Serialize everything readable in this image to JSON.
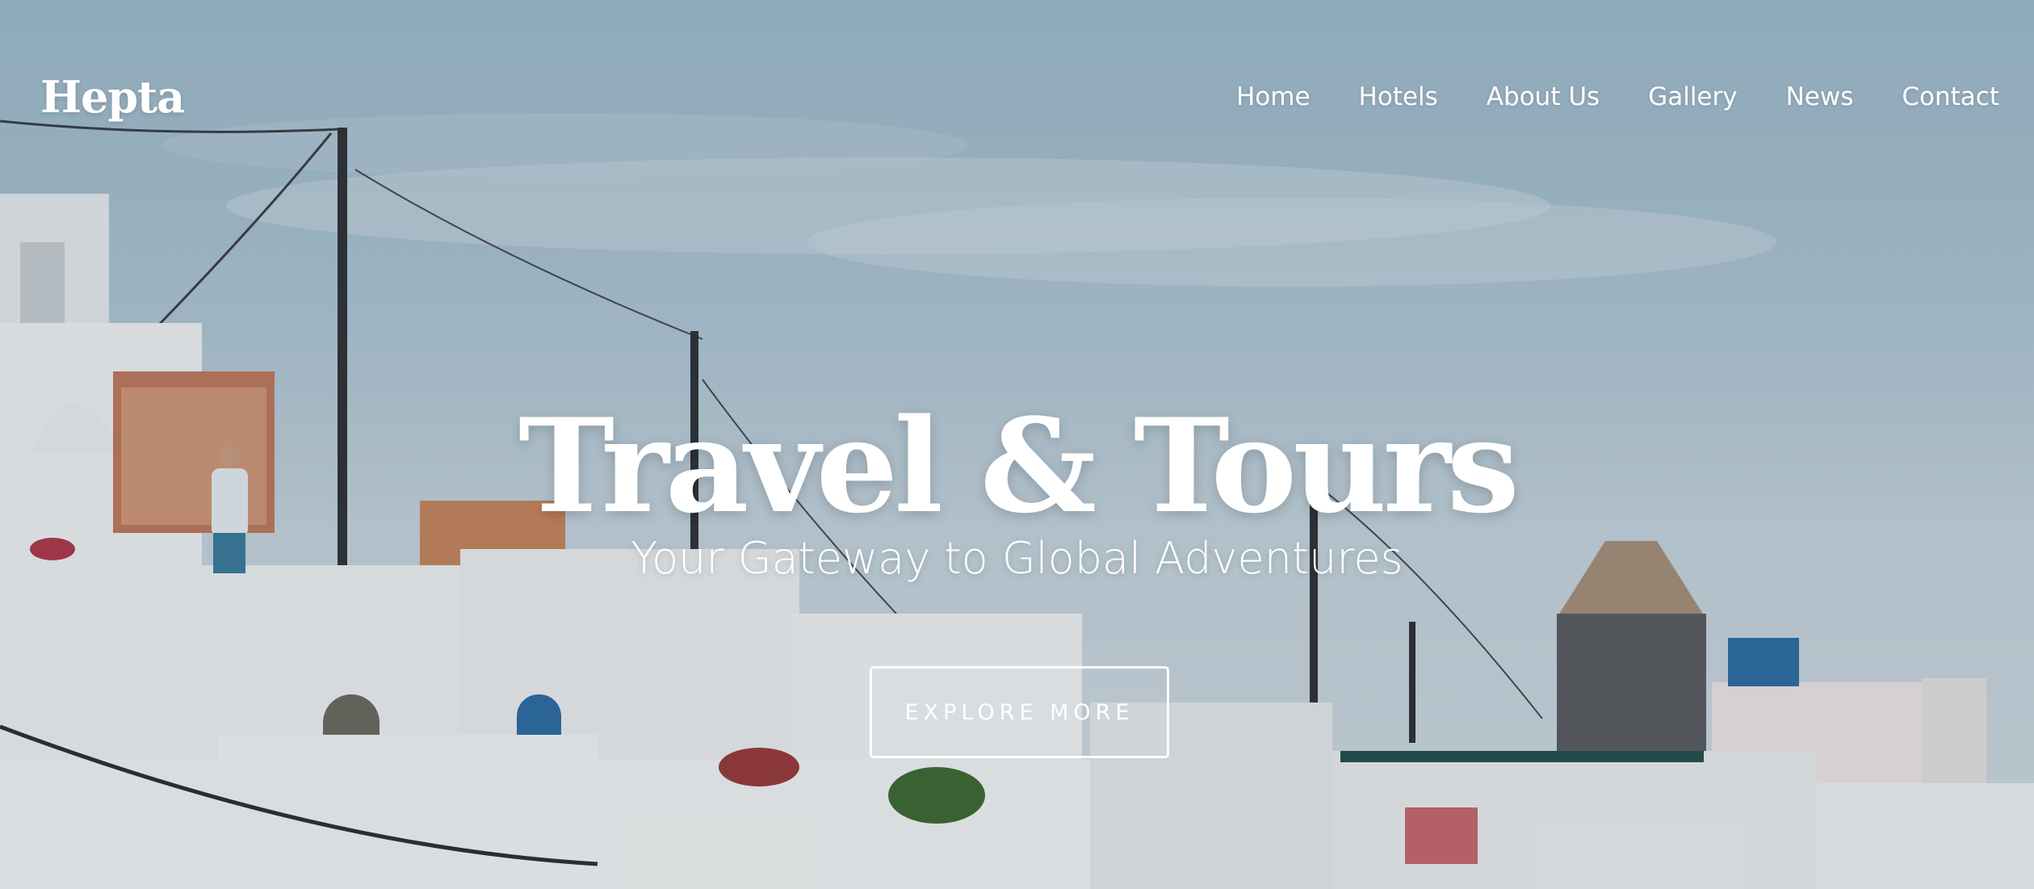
{
  "brand": {
    "logo_text": "Hepta"
  },
  "nav": {
    "items": [
      {
        "label": "Home"
      },
      {
        "label": "Hotels"
      },
      {
        "label": "About Us"
      },
      {
        "label": "Gallery"
      },
      {
        "label": "News"
      },
      {
        "label": "Contact"
      }
    ]
  },
  "hero": {
    "title": "Travel & Tours",
    "subtitle": "Your Gateway to Global Adventures",
    "cta_label": "EXPLORE MORE",
    "background_image": "santorini-village-photo"
  },
  "colors": {
    "text": "#ffffff",
    "sky": "#a9c3d1",
    "walls": "#f3f4f4",
    "door_blue": "#2d6ea3",
    "windmill_stone": "#5b5d5f"
  }
}
